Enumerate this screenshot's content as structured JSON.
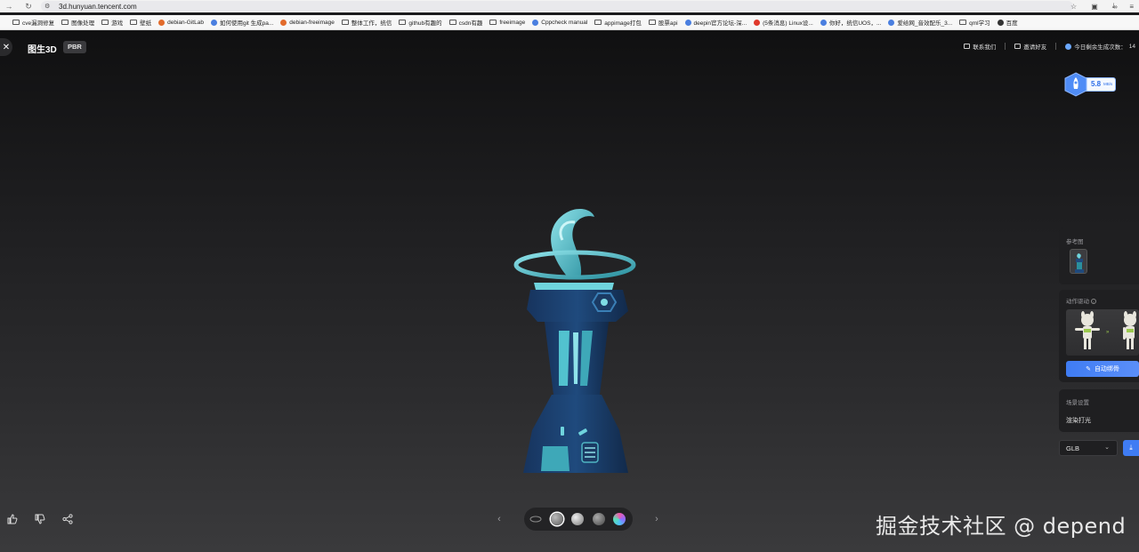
{
  "browser": {
    "url": "3d.hunyuan.tencent.com",
    "bookmarks": [
      {
        "label": "cve漏洞修复",
        "icon": "folder-icon"
      },
      {
        "label": "图像处理",
        "icon": "folder-icon"
      },
      {
        "label": "游戏",
        "icon": "folder-icon"
      },
      {
        "label": "壁纸",
        "icon": "folder-icon"
      },
      {
        "label": "debian-GitLab",
        "icon": "gitlab-icon"
      },
      {
        "label": "如何使用git 生成pa...",
        "icon": "site-icon"
      },
      {
        "label": "debian-freeimage",
        "icon": "gitlab-icon"
      },
      {
        "label": "整体工作，统信",
        "icon": "folder-icon"
      },
      {
        "label": "github有趣的",
        "icon": "folder-icon"
      },
      {
        "label": "csdn有趣",
        "icon": "folder-icon"
      },
      {
        "label": "freeimage",
        "icon": "folder-icon"
      },
      {
        "label": "Cppcheck manual",
        "icon": "site-icon"
      },
      {
        "label": "appimage打包",
        "icon": "folder-icon"
      },
      {
        "label": "股票api",
        "icon": "folder-icon"
      },
      {
        "label": "deepin官方论坛-深...",
        "icon": "site-icon"
      },
      {
        "label": "(5条消息) Linux设...",
        "icon": "csdn-icon"
      },
      {
        "label": "你好，统信UOS，...",
        "icon": "site-icon"
      },
      {
        "label": "爱给网_音效配乐_3...",
        "icon": "site-icon"
      },
      {
        "label": "qml学习",
        "icon": "folder-icon"
      },
      {
        "label": "百度",
        "icon": "globe-icon"
      }
    ],
    "more": "»"
  },
  "header": {
    "close": "✕",
    "title": "图生3D",
    "badge": "PBR",
    "contact": "联系我们",
    "invite": "邀请好友",
    "remaining_label": "今日剩余生成次数：",
    "remaining_count": "14"
  },
  "speed": {
    "value": "5.8",
    "unit": "MB/s"
  },
  "panel": {
    "reference_label": "参考图",
    "motion_label": "动作驱动",
    "auto_rig_label": "自动绑骨",
    "scene_label": "场景设置",
    "render_light_label": "渲染打光"
  },
  "export": {
    "format": "GLB"
  },
  "bottom": {
    "prev": "‹",
    "next": "›"
  },
  "watermark": "掘金技术社区 @ depend"
}
